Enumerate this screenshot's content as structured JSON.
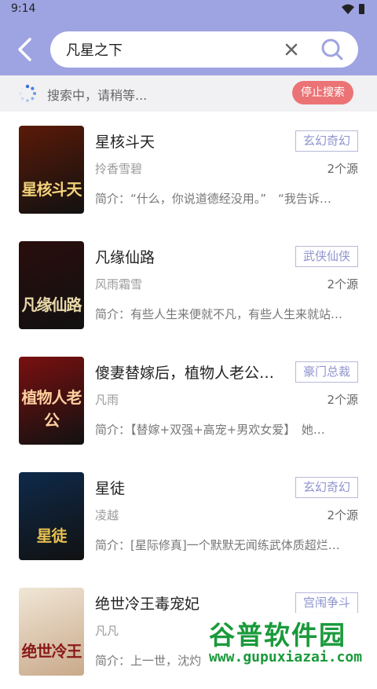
{
  "status_bar": {
    "time": "9:14"
  },
  "search": {
    "query": "凡星之下"
  },
  "progress": {
    "text": "搜索中，请稍等...",
    "stop_label": "停止搜索"
  },
  "results": [
    {
      "title": "星核斗天",
      "tag": "玄幻奇幻",
      "author": "拎香雪碧",
      "sources": "2个源",
      "intro": "简介：“什么，你说道德经没用。”　“我告诉…",
      "cover_title": "星核斗天",
      "cover_bg": "#5a1a08",
      "cover_fg": "#f2d27a"
    },
    {
      "title": "凡缘仙路",
      "tag": "武侠仙侠",
      "author": "风雨霜雪",
      "sources": "2个源",
      "intro": "简介：有些人生来便就不凡，有些人生来就站…",
      "cover_title": "凡缘仙路",
      "cover_bg": "#2a0d0d",
      "cover_fg": "#e8d9a8"
    },
    {
      "title": "傻妻替嫁后，植物人老公…",
      "tag": "豪门总裁",
      "author": "凡雨",
      "sources": "2个源",
      "intro": "简介：【替嫁+双强+高宠+男欢女爱】　她…",
      "cover_title": "植物人老公",
      "cover_bg": "#7a1010",
      "cover_fg": "#ffd0a0"
    },
    {
      "title": "星徒",
      "tag": "玄幻奇幻",
      "author": "凌越",
      "sources": "2个源",
      "intro": "简介：[星际修真]一个默默无闻练武体质超烂…",
      "cover_title": "星徒",
      "cover_bg": "#0e2a4a",
      "cover_fg": "#e8c050"
    },
    {
      "title": "绝世冷王毒宠妃",
      "tag": "宫闱争斗",
      "author": "凡凡",
      "sources": "",
      "intro": "简介：上一世，沈灼",
      "cover_title": "绝世冷王",
      "cover_bg": "#f0e6d6",
      "cover_fg": "#8a1a1a"
    }
  ],
  "watermark": {
    "main": "谷普软件园",
    "url": "www.gupuxiazai.com"
  },
  "icons": {
    "back": "chevron-left-icon",
    "clear": "close-icon",
    "search": "search-icon",
    "spinner": "loading-spinner-icon",
    "wifi": "wifi-icon",
    "battery": "battery-icon"
  },
  "colors": {
    "header": "#9ea3e2",
    "accent": "#8f93cf",
    "stop_button": "#ec7375"
  }
}
